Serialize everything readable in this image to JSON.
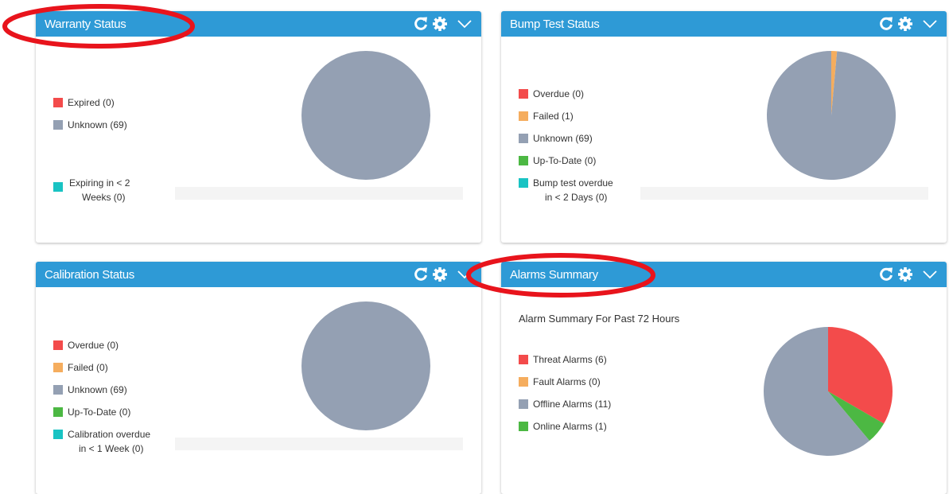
{
  "colors": {
    "header": "#2e9ad6",
    "red": "#f34b4b",
    "orange": "#f5ad5e",
    "gray": "#94a0b3",
    "green": "#4cb843",
    "teal": "#19c3c3",
    "annotation_red": "#e8141c"
  },
  "icons": {
    "refresh": "refresh-icon",
    "settings": "gear-icon",
    "collapse": "chevron-down-icon"
  },
  "warranty": {
    "title": "Warranty Status",
    "legend": [
      {
        "label": "Expired (0)",
        "color": "#f34b4b"
      },
      {
        "label": "Unknown (69)",
        "color": "#94a0b3"
      }
    ],
    "expiring_line1": "Expiring in < 2",
    "expiring_line2": "Weeks (0)",
    "expiring_color": "#19c3c3",
    "chart_data": {
      "type": "pie",
      "categories": [
        "Expired",
        "Unknown",
        "Expiring in < 2 Weeks"
      ],
      "values": [
        0,
        69,
        0
      ]
    }
  },
  "bump": {
    "title": "Bump Test Status",
    "legend": [
      {
        "label": "Overdue (0)",
        "color": "#f34b4b"
      },
      {
        "label": "Failed (1)",
        "color": "#f5ad5e"
      },
      {
        "label": "Unknown (69)",
        "color": "#94a0b3"
      },
      {
        "label": "Up-To-Date (0)",
        "color": "#4cb843"
      }
    ],
    "overdue_line1": "Bump test overdue",
    "overdue_line2": "in < 2 Days (0)",
    "overdue_color": "#19c3c3",
    "chart_data": {
      "type": "pie",
      "categories": [
        "Overdue",
        "Failed",
        "Unknown",
        "Up-To-Date",
        "Bump test overdue in < 2 Days"
      ],
      "values": [
        0,
        1,
        69,
        0,
        0
      ]
    }
  },
  "calibration": {
    "title": "Calibration Status",
    "legend": [
      {
        "label": "Overdue (0)",
        "color": "#f34b4b"
      },
      {
        "label": "Failed (0)",
        "color": "#f5ad5e"
      },
      {
        "label": "Unknown (69)",
        "color": "#94a0b3"
      },
      {
        "label": "Up-To-Date (0)",
        "color": "#4cb843"
      }
    ],
    "overdue_line1": "Calibration overdue",
    "overdue_line2": "in < 1 Week (0)",
    "overdue_color": "#19c3c3",
    "chart_data": {
      "type": "pie",
      "categories": [
        "Overdue",
        "Failed",
        "Unknown",
        "Up-To-Date",
        "Calibration overdue in < 1 Week"
      ],
      "values": [
        0,
        0,
        69,
        0,
        0
      ]
    }
  },
  "alarms": {
    "title": "Alarms Summary",
    "subtitle": "Alarm Summary For Past 72 Hours",
    "legend": [
      {
        "label": "Threat Alarms (6)",
        "color": "#f34b4b"
      },
      {
        "label": "Fault Alarms (0)",
        "color": "#f5ad5e"
      },
      {
        "label": "Offline Alarms (11)",
        "color": "#94a0b3"
      },
      {
        "label": "Online Alarms (1)",
        "color": "#4cb843"
      }
    ],
    "chart_data": {
      "type": "pie",
      "categories": [
        "Threat Alarms",
        "Fault Alarms",
        "Offline Alarms",
        "Online Alarms"
      ],
      "values": [
        6,
        0,
        11,
        1
      ],
      "slice_order": [
        "Threat Alarms",
        "Online Alarms",
        "Offline Alarms"
      ]
    }
  }
}
